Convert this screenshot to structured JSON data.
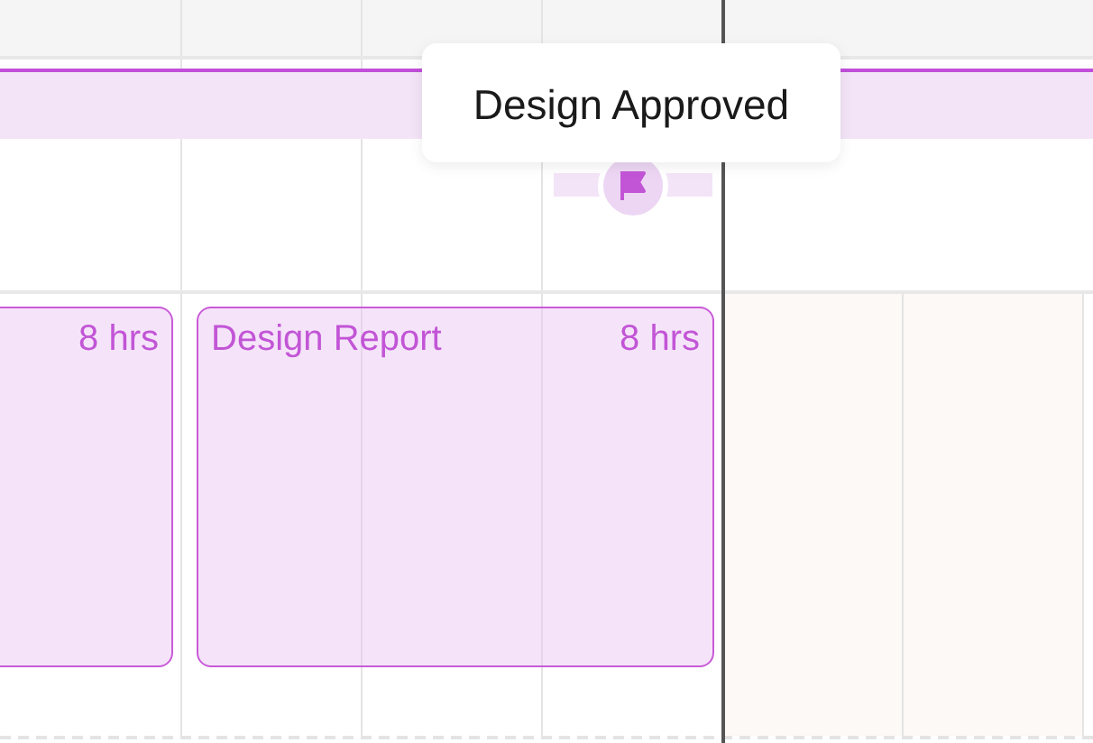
{
  "summary_bar": {
    "kind": "summary"
  },
  "milestone": {
    "tooltip": "Design Approved"
  },
  "tasks": [
    {
      "hours": "8 hrs"
    },
    {
      "name": "Design Report",
      "hours": "8 hrs"
    }
  ]
}
